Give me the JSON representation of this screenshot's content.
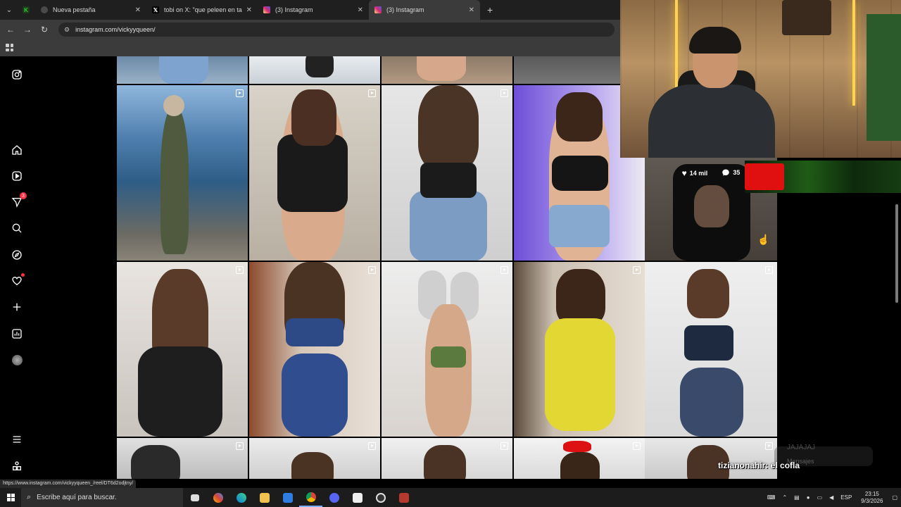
{
  "browser": {
    "tabs": [
      {
        "label": "Nueva pestaña",
        "icon": "chrome-icon",
        "color": "#4a4a4a"
      },
      {
        "label": "tobi on X: \"que peleen en tang",
        "icon": "x-icon",
        "color": "#000000"
      },
      {
        "label": "(3) Instagram",
        "icon": "instagram-icon",
        "color": "#d6249f"
      },
      {
        "label": "(3) Instagram",
        "icon": "instagram-icon",
        "color": "#d6249f"
      }
    ],
    "active_tab": 3,
    "url": "instagram.com/vickyyqueen/",
    "status_url": "https://www.instagram.com/vickyyqueen_/reel/DT6d2odjtny/"
  },
  "sidebar": {
    "items": [
      {
        "name": "instagram-logo-icon"
      },
      {
        "name": "home-icon"
      },
      {
        "name": "reels-icon"
      },
      {
        "name": "messages-icon",
        "badge": "3"
      },
      {
        "name": "search-icon"
      },
      {
        "name": "explore-icon"
      },
      {
        "name": "notifications-icon"
      },
      {
        "name": "create-icon"
      },
      {
        "name": "dashboard-icon"
      },
      {
        "name": "profile-avatar-icon"
      },
      {
        "name": "more-menu-icon"
      },
      {
        "name": "also-from-meta-icon"
      }
    ]
  },
  "hover_post": {
    "likes": "14 mil",
    "comments": "35"
  },
  "chat": {
    "user": "tizianonahir",
    "message": ": el cofla",
    "faint_line_1": "JAJAJAJ",
    "faint_line_2": "Mensajes"
  },
  "taskbar": {
    "search_placeholder": "Escribe aquí para buscar.",
    "tray_lang": "ESP",
    "time": "23:15",
    "date": "9/3/2026"
  },
  "colors": {
    "accent_notification": "#ff3040",
    "instagram_bg": "#000000"
  }
}
